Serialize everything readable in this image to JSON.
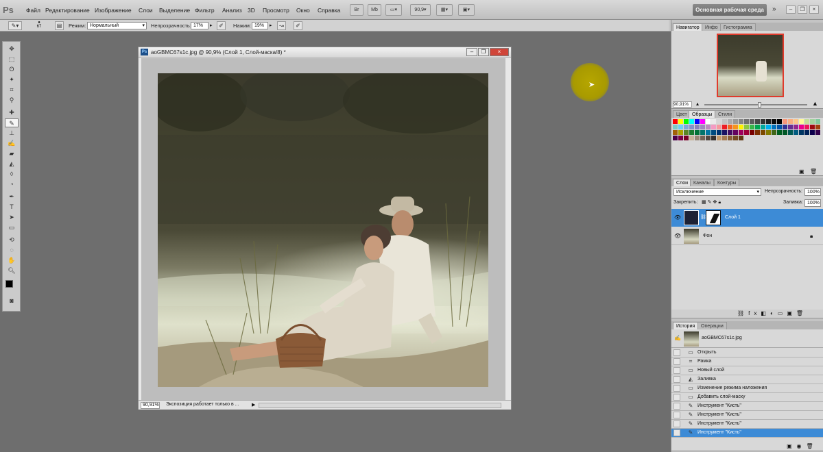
{
  "app": {
    "logo": "Ps"
  },
  "menu": [
    "Файл",
    "Редактирование",
    "Изображение",
    "Слои",
    "Выделение",
    "Фильтр",
    "Анализ",
    "3D",
    "Просмотр",
    "Окно",
    "Справка"
  ],
  "menubar": {
    "zoom": "90,9",
    "workspace": "Основная рабочая среда",
    "btn_br": "Br",
    "btn_mb": "Mb"
  },
  "options": {
    "brush_size": "67",
    "mode_label": "Режим:",
    "mode_value": "Нормальный",
    "opacity_label": "Непрозрачность:",
    "opacity_value": "17%",
    "pressure_label": "Нажим:",
    "pressure_value": "19%"
  },
  "document": {
    "title": "aoGBMC67s1c.jpg @ 90,9% (Слой 1, Слой-маска/8) *",
    "status_zoom": "90,91%",
    "status_text": "Экспозиция работает только в ..."
  },
  "navigator": {
    "tabs": [
      "Навигатор",
      "Инфо",
      "Гистограмма"
    ],
    "zoom": "90,91%"
  },
  "swatches": {
    "tabs": [
      "Цвет",
      "Образцы",
      "Стили"
    ]
  },
  "layers": {
    "tabs": [
      "Слои",
      "Каналы",
      "Контуры"
    ],
    "blend_mode": "Исключение",
    "opacity_label": "Непрозрачность:",
    "opacity_value": "100%",
    "lock_label": "Закрепить:",
    "fill_label": "Заливка:",
    "fill_value": "100%",
    "items": [
      {
        "name": "Слой 1",
        "selected": true
      },
      {
        "name": "Фон",
        "selected": false
      }
    ]
  },
  "history": {
    "tabs": [
      "История",
      "Операции"
    ],
    "snapshot": "aoGBMC67s1c.jpg",
    "items": [
      {
        "label": "Открыть"
      },
      {
        "label": "Рамка"
      },
      {
        "label": "Новый слой"
      },
      {
        "label": "Заливка"
      },
      {
        "label": "Изменение режима наложения"
      },
      {
        "label": "Добавить слой-маску"
      },
      {
        "label": "Инструмент \"Кисть\""
      },
      {
        "label": "Инструмент \"Кисть\""
      },
      {
        "label": "Инструмент \"Кисть\""
      },
      {
        "label": "Инструмент \"Кисть\"",
        "selected": true
      }
    ]
  }
}
